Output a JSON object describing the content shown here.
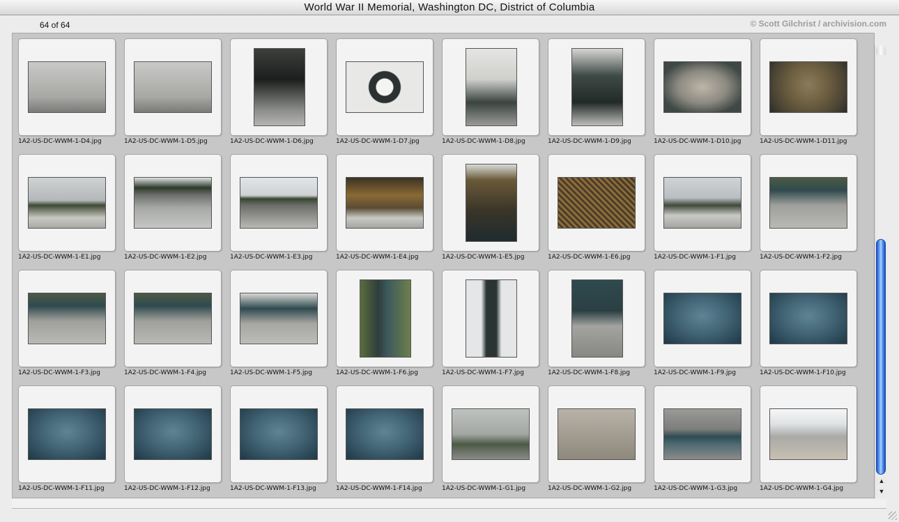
{
  "window": {
    "title": "World War II Memorial, Washington DC, District of Columbia"
  },
  "header": {
    "count": "64 of 64",
    "credit": "© Scott Gilchrist / archivision.com"
  },
  "grid": {
    "images": [
      {
        "file": "1A2-US-DC-WWM-1-D4.jpg",
        "orientation": "land",
        "palette": "stone"
      },
      {
        "file": "1A2-US-DC-WWM-1-D5.jpg",
        "orientation": "land",
        "palette": "stone"
      },
      {
        "file": "1A2-US-DC-WWM-1-D6.jpg",
        "orientation": "port",
        "palette": "dark"
      },
      {
        "file": "1A2-US-DC-WWM-1-D7.jpg",
        "orientation": "land",
        "palette": "bronze-sky"
      },
      {
        "file": "1A2-US-DC-WWM-1-D8.jpg",
        "orientation": "port",
        "palette": "arch"
      },
      {
        "file": "1A2-US-DC-WWM-1-D9.jpg",
        "orientation": "port",
        "palette": "bronze"
      },
      {
        "file": "1A2-US-DC-WWM-1-D10.jpg",
        "orientation": "land",
        "palette": "floor"
      },
      {
        "file": "1A2-US-DC-WWM-1-D11.jpg",
        "orientation": "land",
        "palette": "medal"
      },
      {
        "file": "1A2-US-DC-WWM-1-E1.jpg",
        "orientation": "land",
        "palette": "vista"
      },
      {
        "file": "1A2-US-DC-WWM-1-E2.jpg",
        "orientation": "land",
        "palette": "plaza"
      },
      {
        "file": "1A2-US-DC-WWM-1-E3.jpg",
        "orientation": "land",
        "palette": "plaza-sky"
      },
      {
        "file": "1A2-US-DC-WWM-1-E4.jpg",
        "orientation": "land",
        "palette": "stars"
      },
      {
        "file": "1A2-US-DC-WWM-1-E5.jpg",
        "orientation": "port",
        "palette": "stars-dark"
      },
      {
        "file": "1A2-US-DC-WWM-1-E6.jpg",
        "orientation": "land",
        "palette": "stars-gold"
      },
      {
        "file": "1A2-US-DC-WWM-1-F1.jpg",
        "orientation": "land",
        "palette": "statue"
      },
      {
        "file": "1A2-US-DC-WWM-1-F2.jpg",
        "orientation": "land",
        "palette": "base-green"
      },
      {
        "file": "1A2-US-DC-WWM-1-F3.jpg",
        "orientation": "land",
        "palette": "base-green"
      },
      {
        "file": "1A2-US-DC-WWM-1-F4.jpg",
        "orientation": "land",
        "palette": "base-green"
      },
      {
        "file": "1A2-US-DC-WWM-1-F5.jpg",
        "orientation": "land",
        "palette": "base-grey"
      },
      {
        "file": "1A2-US-DC-WWM-1-F6.jpg",
        "orientation": "port",
        "palette": "pillar-tree"
      },
      {
        "file": "1A2-US-DC-WWM-1-F7.jpg",
        "orientation": "port",
        "palette": "pillar-sky"
      },
      {
        "file": "1A2-US-DC-WWM-1-F8.jpg",
        "orientation": "port",
        "palette": "base-dark"
      },
      {
        "file": "1A2-US-DC-WWM-1-F9.jpg",
        "orientation": "land",
        "palette": "seal"
      },
      {
        "file": "1A2-US-DC-WWM-1-F10.jpg",
        "orientation": "land",
        "palette": "seal"
      },
      {
        "file": "1A2-US-DC-WWM-1-F11.jpg",
        "orientation": "land",
        "palette": "seal"
      },
      {
        "file": "1A2-US-DC-WWM-1-F12.jpg",
        "orientation": "land",
        "palette": "seal"
      },
      {
        "file": "1A2-US-DC-WWM-1-F13.jpg",
        "orientation": "land",
        "palette": "seal"
      },
      {
        "file": "1A2-US-DC-WWM-1-F14.jpg",
        "orientation": "land",
        "palette": "seal"
      },
      {
        "file": "1A2-US-DC-WWM-1-G1.jpg",
        "orientation": "land",
        "palette": "wall"
      },
      {
        "file": "1A2-US-DC-WWM-1-G2.jpg",
        "orientation": "land",
        "palette": "plaque"
      },
      {
        "file": "1A2-US-DC-WWM-1-G3.jpg",
        "orientation": "land",
        "palette": "frieze"
      },
      {
        "file": "1A2-US-DC-WWM-1-G4.jpg",
        "orientation": "land",
        "palette": "building"
      }
    ]
  },
  "palettes": {
    "stone": "linear-gradient(180deg,#c9c9c7 0%,#a7a7a4 70%,#7a7a78 100%)",
    "dark": "linear-gradient(180deg,#3c3f3c 0%,#1c1e1d 40%,#8b8d8a 80%,#b5b5b2 100%)",
    "bronze-sky": "radial-gradient(circle at 50% 50%,#f4f4f2 18%,#2a3130 20%,#2a3130 34%,#e8e8e6 36%)",
    "arch": "linear-gradient(180deg,#e5e5e3 0%,#cfcfcc 40%,#3a4440 70%,#9a9a96 100%)",
    "bronze": "linear-gradient(180deg,#d6d6d4 0%,#3f4a46 35%,#222a27 70%,#bdbdba 100%)",
    "floor": "radial-gradient(ellipse at 50% 50%,#bcb6a8 0%,#8d8a82 45%,#3f4844 80%)",
    "medal": "radial-gradient(circle at 50% 45%,#8a7c5a 0%,#6a5c3e 45%,#4c4535 75%,#2e2c26 100%)",
    "vista": "linear-gradient(180deg,#cfd2d3 0%,#b4b8ba 45%,#3f4a34 55%,#c9c9c4 80%,#a9a9a4 100%)",
    "plaza": "linear-gradient(180deg,#dfe2e4 0%,#2d3a2b 20%,#6d706d 35%,#a7a9a7 60%,#c6c7c4 100%)",
    "plaza-sky": "linear-gradient(180deg,#e2e5e7 0%,#ced2d5 35%,#38452f 42%,#6c6e6a 55%,#b8b8b5 100%)",
    "stars": "linear-gradient(180deg,#3b3224 0%,#8a6a33 35%,#5a4b33 60%,#c8c8c4 80%,#a5a5a1 100%)",
    "stars-dark": "linear-gradient(180deg,#d8dbd8 0%,#6b5a39 20%,#3a3528 60%,#1f2b2f 100%)",
    "stars-gold": "repeating-linear-gradient(45deg,#8a6c3a 0 3px,#4a3b28 3px 6px)",
    "statue": "linear-gradient(180deg,#cfd3d6 0%,#b9bec2 40%,#3e4a3a 55%,#c9c9c6 75%,#a4a4a1 100%)",
    "base-green": "linear-gradient(180deg,#4c5a44 0%,#2f4a4f 25%,#9fa09c 55%,#b9b9b6 100%)",
    "base-grey": "linear-gradient(180deg,#d8d8d6 0%,#2f4a4f 30%,#a6a6a3 60%,#bcbcb9 100%)",
    "pillar-tree": "linear-gradient(90deg,#5a6e3e 0%,#2f3e3b 35%,#3d5a5c 55%,#6e7f4c 100%)",
    "pillar-sky": "linear-gradient(90deg,#e4e6e8 0%,#e4e6e8 30%,#2a3533 40%,#2a3533 60%,#e4e6e8 70%)",
    "base-dark": "linear-gradient(180deg,#2f4a4f 0%,#2b3f43 40%,#a3a39f 60%,#878784 100%)",
    "seal": "radial-gradient(ellipse at 50% 45%,#5e8494 0%,#46697a 40%,#2f4d5c 75%,#1f3846 100%)",
    "wall": "linear-gradient(180deg,#bfc3bf 0%,#a3a6a2 50%,#4d5a46 70%,#8a8c88 100%)",
    "plaque": "linear-gradient(180deg,#b8b2a8 0%,#a39d92 50%,#8e887d 100%)",
    "frieze": "linear-gradient(180deg,#9a9a97 0%,#7d7e7b 40%,#2f4a53 55%,#4e6b72 70%,#8b8b88 100%)",
    "building": "linear-gradient(180deg,#f5f6f7 0%,#dfe2e4 30%,#a9aaa6 55%,#c8bfb2 100%)"
  }
}
